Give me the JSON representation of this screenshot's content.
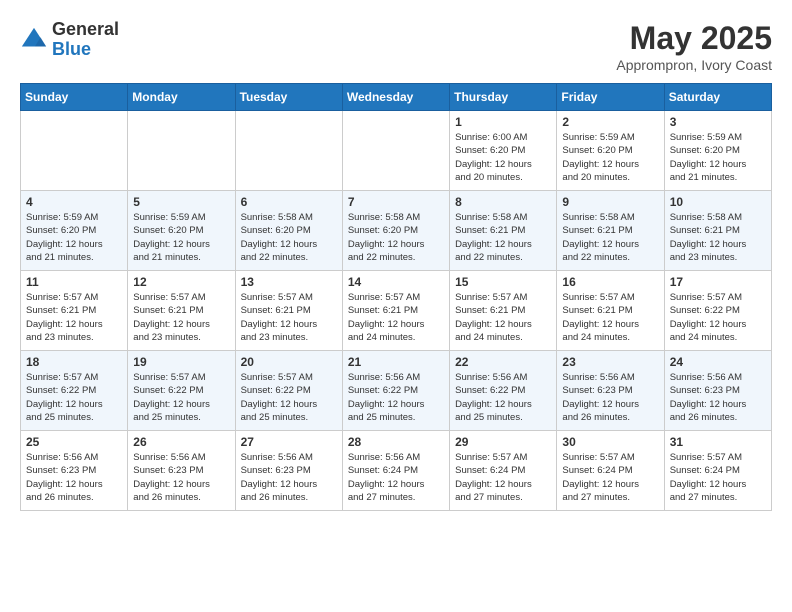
{
  "header": {
    "logo_general": "General",
    "logo_blue": "Blue",
    "month_title": "May 2025",
    "subtitle": "Apprompron, Ivory Coast"
  },
  "days_of_week": [
    "Sunday",
    "Monday",
    "Tuesday",
    "Wednesday",
    "Thursday",
    "Friday",
    "Saturday"
  ],
  "weeks": [
    [
      {
        "day": "",
        "info": ""
      },
      {
        "day": "",
        "info": ""
      },
      {
        "day": "",
        "info": ""
      },
      {
        "day": "",
        "info": ""
      },
      {
        "day": "1",
        "info": "Sunrise: 6:00 AM\nSunset: 6:20 PM\nDaylight: 12 hours\nand 20 minutes."
      },
      {
        "day": "2",
        "info": "Sunrise: 5:59 AM\nSunset: 6:20 PM\nDaylight: 12 hours\nand 20 minutes."
      },
      {
        "day": "3",
        "info": "Sunrise: 5:59 AM\nSunset: 6:20 PM\nDaylight: 12 hours\nand 21 minutes."
      }
    ],
    [
      {
        "day": "4",
        "info": "Sunrise: 5:59 AM\nSunset: 6:20 PM\nDaylight: 12 hours\nand 21 minutes."
      },
      {
        "day": "5",
        "info": "Sunrise: 5:59 AM\nSunset: 6:20 PM\nDaylight: 12 hours\nand 21 minutes."
      },
      {
        "day": "6",
        "info": "Sunrise: 5:58 AM\nSunset: 6:20 PM\nDaylight: 12 hours\nand 22 minutes."
      },
      {
        "day": "7",
        "info": "Sunrise: 5:58 AM\nSunset: 6:20 PM\nDaylight: 12 hours\nand 22 minutes."
      },
      {
        "day": "8",
        "info": "Sunrise: 5:58 AM\nSunset: 6:21 PM\nDaylight: 12 hours\nand 22 minutes."
      },
      {
        "day": "9",
        "info": "Sunrise: 5:58 AM\nSunset: 6:21 PM\nDaylight: 12 hours\nand 22 minutes."
      },
      {
        "day": "10",
        "info": "Sunrise: 5:58 AM\nSunset: 6:21 PM\nDaylight: 12 hours\nand 23 minutes."
      }
    ],
    [
      {
        "day": "11",
        "info": "Sunrise: 5:57 AM\nSunset: 6:21 PM\nDaylight: 12 hours\nand 23 minutes."
      },
      {
        "day": "12",
        "info": "Sunrise: 5:57 AM\nSunset: 6:21 PM\nDaylight: 12 hours\nand 23 minutes."
      },
      {
        "day": "13",
        "info": "Sunrise: 5:57 AM\nSunset: 6:21 PM\nDaylight: 12 hours\nand 23 minutes."
      },
      {
        "day": "14",
        "info": "Sunrise: 5:57 AM\nSunset: 6:21 PM\nDaylight: 12 hours\nand 24 minutes."
      },
      {
        "day": "15",
        "info": "Sunrise: 5:57 AM\nSunset: 6:21 PM\nDaylight: 12 hours\nand 24 minutes."
      },
      {
        "day": "16",
        "info": "Sunrise: 5:57 AM\nSunset: 6:21 PM\nDaylight: 12 hours\nand 24 minutes."
      },
      {
        "day": "17",
        "info": "Sunrise: 5:57 AM\nSunset: 6:22 PM\nDaylight: 12 hours\nand 24 minutes."
      }
    ],
    [
      {
        "day": "18",
        "info": "Sunrise: 5:57 AM\nSunset: 6:22 PM\nDaylight: 12 hours\nand 25 minutes."
      },
      {
        "day": "19",
        "info": "Sunrise: 5:57 AM\nSunset: 6:22 PM\nDaylight: 12 hours\nand 25 minutes."
      },
      {
        "day": "20",
        "info": "Sunrise: 5:57 AM\nSunset: 6:22 PM\nDaylight: 12 hours\nand 25 minutes."
      },
      {
        "day": "21",
        "info": "Sunrise: 5:56 AM\nSunset: 6:22 PM\nDaylight: 12 hours\nand 25 minutes."
      },
      {
        "day": "22",
        "info": "Sunrise: 5:56 AM\nSunset: 6:22 PM\nDaylight: 12 hours\nand 25 minutes."
      },
      {
        "day": "23",
        "info": "Sunrise: 5:56 AM\nSunset: 6:23 PM\nDaylight: 12 hours\nand 26 minutes."
      },
      {
        "day": "24",
        "info": "Sunrise: 5:56 AM\nSunset: 6:23 PM\nDaylight: 12 hours\nand 26 minutes."
      }
    ],
    [
      {
        "day": "25",
        "info": "Sunrise: 5:56 AM\nSunset: 6:23 PM\nDaylight: 12 hours\nand 26 minutes."
      },
      {
        "day": "26",
        "info": "Sunrise: 5:56 AM\nSunset: 6:23 PM\nDaylight: 12 hours\nand 26 minutes."
      },
      {
        "day": "27",
        "info": "Sunrise: 5:56 AM\nSunset: 6:23 PM\nDaylight: 12 hours\nand 26 minutes."
      },
      {
        "day": "28",
        "info": "Sunrise: 5:56 AM\nSunset: 6:24 PM\nDaylight: 12 hours\nand 27 minutes."
      },
      {
        "day": "29",
        "info": "Sunrise: 5:57 AM\nSunset: 6:24 PM\nDaylight: 12 hours\nand 27 minutes."
      },
      {
        "day": "30",
        "info": "Sunrise: 5:57 AM\nSunset: 6:24 PM\nDaylight: 12 hours\nand 27 minutes."
      },
      {
        "day": "31",
        "info": "Sunrise: 5:57 AM\nSunset: 6:24 PM\nDaylight: 12 hours\nand 27 minutes."
      }
    ]
  ]
}
